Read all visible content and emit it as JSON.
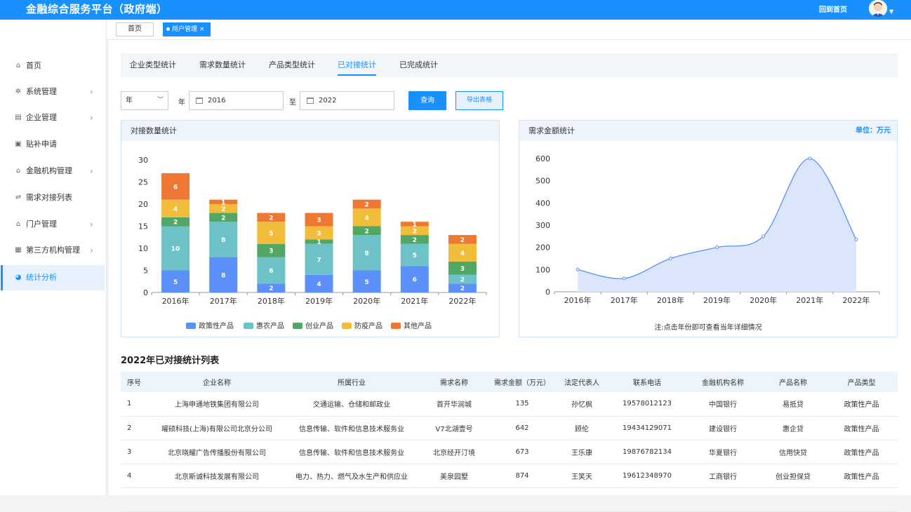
{
  "app": {
    "title": "金融综合服务平台（政府端）",
    "home_link": "回到首页"
  },
  "sidebar": {
    "items": [
      {
        "label": "首页",
        "icon": "home-icon",
        "arrow": false,
        "active": false
      },
      {
        "label": "系统管理",
        "icon": "gear-icon",
        "arrow": true,
        "active": false
      },
      {
        "label": "企业管理",
        "icon": "building-icon",
        "arrow": true,
        "active": false
      },
      {
        "label": "贴补申请",
        "icon": "card-icon",
        "arrow": false,
        "active": false
      },
      {
        "label": "金融机构管理",
        "icon": "bank-icon",
        "arrow": true,
        "active": false
      },
      {
        "label": "需求对接列表",
        "icon": "swap-icon",
        "arrow": false,
        "active": false
      },
      {
        "label": "门户管理",
        "icon": "home-icon",
        "arrow": true,
        "active": false
      },
      {
        "label": "第三方机构管理",
        "icon": "grid-icon",
        "arrow": true,
        "active": false
      },
      {
        "label": "统计分析",
        "icon": "pie-icon",
        "arrow": false,
        "active": true
      }
    ]
  },
  "tabs": {
    "home": "首页",
    "user": "用户管理"
  },
  "subtabs": [
    "企业类型统计",
    "需求数量统计",
    "产品类型统计",
    "已对接统计",
    "已完成统计"
  ],
  "filters": {
    "period": "年",
    "year_label": "年",
    "from": "2016",
    "to_label": "至",
    "to": "2022",
    "query_button": "查询",
    "export_button": "导出表格"
  },
  "left_panel": {
    "title": "对接数量统计"
  },
  "right_panel": {
    "title": "需求金额统计",
    "unit": "单位：万元",
    "note": "注:点击年份即可查看当年详细情况"
  },
  "colors": {
    "primary": "#1890ff"
  },
  "chart_data": [
    {
      "type": "bar",
      "stacked": true,
      "categories": [
        "2016年",
        "2017年",
        "2018年",
        "2019年",
        "2020年",
        "2021年",
        "2022年"
      ],
      "series": [
        {
          "name": "政策性产品",
          "color": "#5b8ff9",
          "values": [
            5,
            8,
            2,
            4,
            5,
            6,
            2
          ]
        },
        {
          "name": "惠农产品",
          "color": "#6cc2c6",
          "values": [
            10,
            8,
            6,
            7,
            8,
            5,
            2
          ]
        },
        {
          "name": "创业产品",
          "color": "#52a764",
          "values": [
            2,
            2,
            3,
            1,
            2,
            2,
            3
          ]
        },
        {
          "name": "防疫产品",
          "color": "#f3bd3c",
          "values": [
            4,
            2,
            5,
            3,
            4,
            2,
            4
          ]
        },
        {
          "name": "其他产品",
          "color": "#ee7733",
          "values": [
            6,
            1,
            2,
            3,
            2,
            1,
            2
          ]
        }
      ],
      "ylim": [
        0,
        30
      ],
      "yticks": [
        0,
        5,
        10,
        15,
        20,
        25,
        30
      ],
      "legend": "bottom"
    },
    {
      "type": "area",
      "categories": [
        "2016年",
        "2017年",
        "2018年",
        "2019年",
        "2020年",
        "2021年",
        "2022年"
      ],
      "values": [
        100,
        60,
        150,
        200,
        250,
        600,
        235
      ],
      "ylim": [
        0,
        600
      ],
      "yticks": [
        0,
        100,
        200,
        300,
        400,
        500,
        600
      ],
      "color": "#5b8ff9"
    }
  ],
  "table": {
    "title": "2022年已对接统计列表",
    "headers": [
      "序号",
      "企业名称",
      "所属行业",
      "需求名称",
      "需求金额（万元）",
      "法定代表人",
      "联系电话",
      "金融机构名称",
      "产品名称",
      "产品类型"
    ],
    "rows": [
      [
        "1",
        "上海申通地铁集团有限公司",
        "交通运输、仓储和邮政业",
        "首开华润城",
        "135",
        "孙忆枫",
        "19578012123",
        "中国银行",
        "易抵贷",
        "政策性产品"
      ],
      [
        "2",
        "曜硕科技(上海)有限公司北京分公司",
        "信息传输、软件和信息技术服务业",
        "V7北湖壹号",
        "642",
        "顾伦",
        "19434129071",
        "建设银行",
        "惠企贷",
        "政策性产品"
      ],
      [
        "3",
        "北京晓耀广告传播股份有限公司",
        "信息传输、软件和信息技术服务业",
        "北京经开汀境",
        "673",
        "王乐康",
        "19876782134",
        "华夏银行",
        "信用快贷",
        "政策性产品"
      ],
      [
        "4",
        "北京斯诚科技发展有限公司",
        "电力、热力、燃气及水生产和供应业",
        "美泉园墅",
        "874",
        "王笑天",
        "19612348970",
        "工商银行",
        "创业担保贷",
        "政策性产品"
      ]
    ]
  }
}
